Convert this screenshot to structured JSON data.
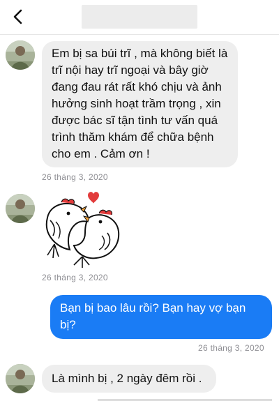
{
  "header": {
    "back_icon": "chevron-left-icon",
    "title": ""
  },
  "colors": {
    "incoming_bubble": "#eeeeee",
    "outgoing_bubble": "#1a7cf5",
    "timestamp": "#8e8e93"
  },
  "messages": [
    {
      "direction": "incoming",
      "text": "Em bị sa búi trĩ , mà không biết là trĩ nội hay trĩ ngoại và bây giờ đang đau rát rất khó chịu và ảnh hưởng sinh hoạt trầm trọng , xin được bác sĩ tận tình tư vấn quá trình thăm khám để chữa bệnh cho em . Cảm ơn !",
      "time": "26 tháng 3, 2020"
    },
    {
      "direction": "incoming",
      "type": "sticker",
      "sticker": "kissing-chickens-sticker",
      "time": "26 tháng 3, 2020"
    },
    {
      "direction": "outgoing",
      "text": "Bạn bị bao lâu rồi? Bạn hay vợ bạn bị?",
      "time": "26 tháng 3, 2020"
    },
    {
      "direction": "incoming",
      "text": "Là mình bị , 2 ngày đêm rồi ."
    }
  ]
}
